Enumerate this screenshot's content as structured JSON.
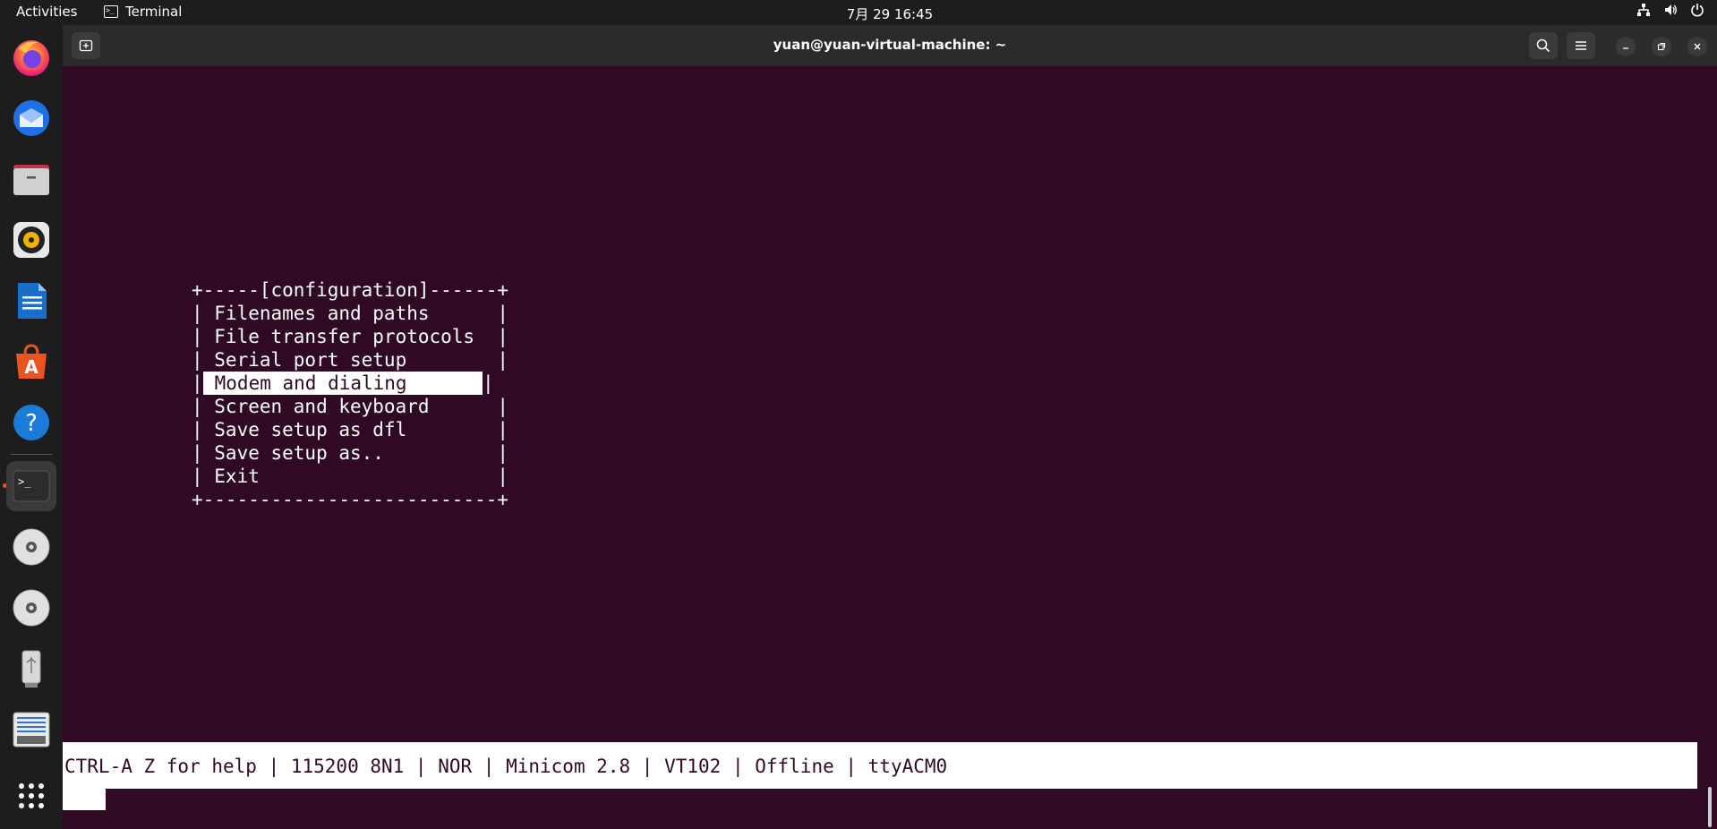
{
  "topbar": {
    "activities": "Activities",
    "app_name": "Terminal",
    "clock": "7月 29  16:45",
    "tray_icons": [
      "network-icon",
      "volume-icon",
      "power-icon"
    ]
  },
  "dock": {
    "items": [
      {
        "name": "firefox",
        "icon": "firefox-icon"
      },
      {
        "name": "thunderbird",
        "icon": "thunderbird-icon"
      },
      {
        "name": "files",
        "icon": "files-icon"
      },
      {
        "name": "rhythmbox",
        "icon": "rhythmbox-icon"
      },
      {
        "name": "writer",
        "icon": "writer-icon"
      },
      {
        "name": "app-center",
        "icon": "app-center-icon"
      },
      {
        "name": "help",
        "icon": "help-icon"
      },
      {
        "name": "terminal",
        "icon": "terminal-icon",
        "active": true
      },
      {
        "name": "disc-1",
        "icon": "disc-icon"
      },
      {
        "name": "disc-2",
        "icon": "disc-icon"
      },
      {
        "name": "usb",
        "icon": "usb-icon"
      },
      {
        "name": "text-editor",
        "icon": "document-icon"
      },
      {
        "name": "show-apps",
        "icon": "grid-icon"
      }
    ]
  },
  "window": {
    "title": "yuan@yuan-virtual-machine: ~"
  },
  "terminal": {
    "menu_top": "+-----[configuration]------+",
    "menu_items": [
      "| Filenames and paths      |",
      "| File transfer protocols  |",
      "| Serial port setup        |",
      "|",
      "| Screen and keyboard      |",
      "| Save setup as dfl        |",
      "| Save setup as..          |",
      "| Exit                     |"
    ],
    "highlighted_item": " Modem and dialing",
    "highlighted_right_border": "|",
    "menu_bottom": "+--------------------------+",
    "status_line": "CTRL-A Z for help | 115200 8N1 | NOR | Minicom 2.8 | VT102 | Offline | ttyACM0"
  },
  "colors": {
    "terminal_bg": "#300a24",
    "accent": "#e95420"
  }
}
